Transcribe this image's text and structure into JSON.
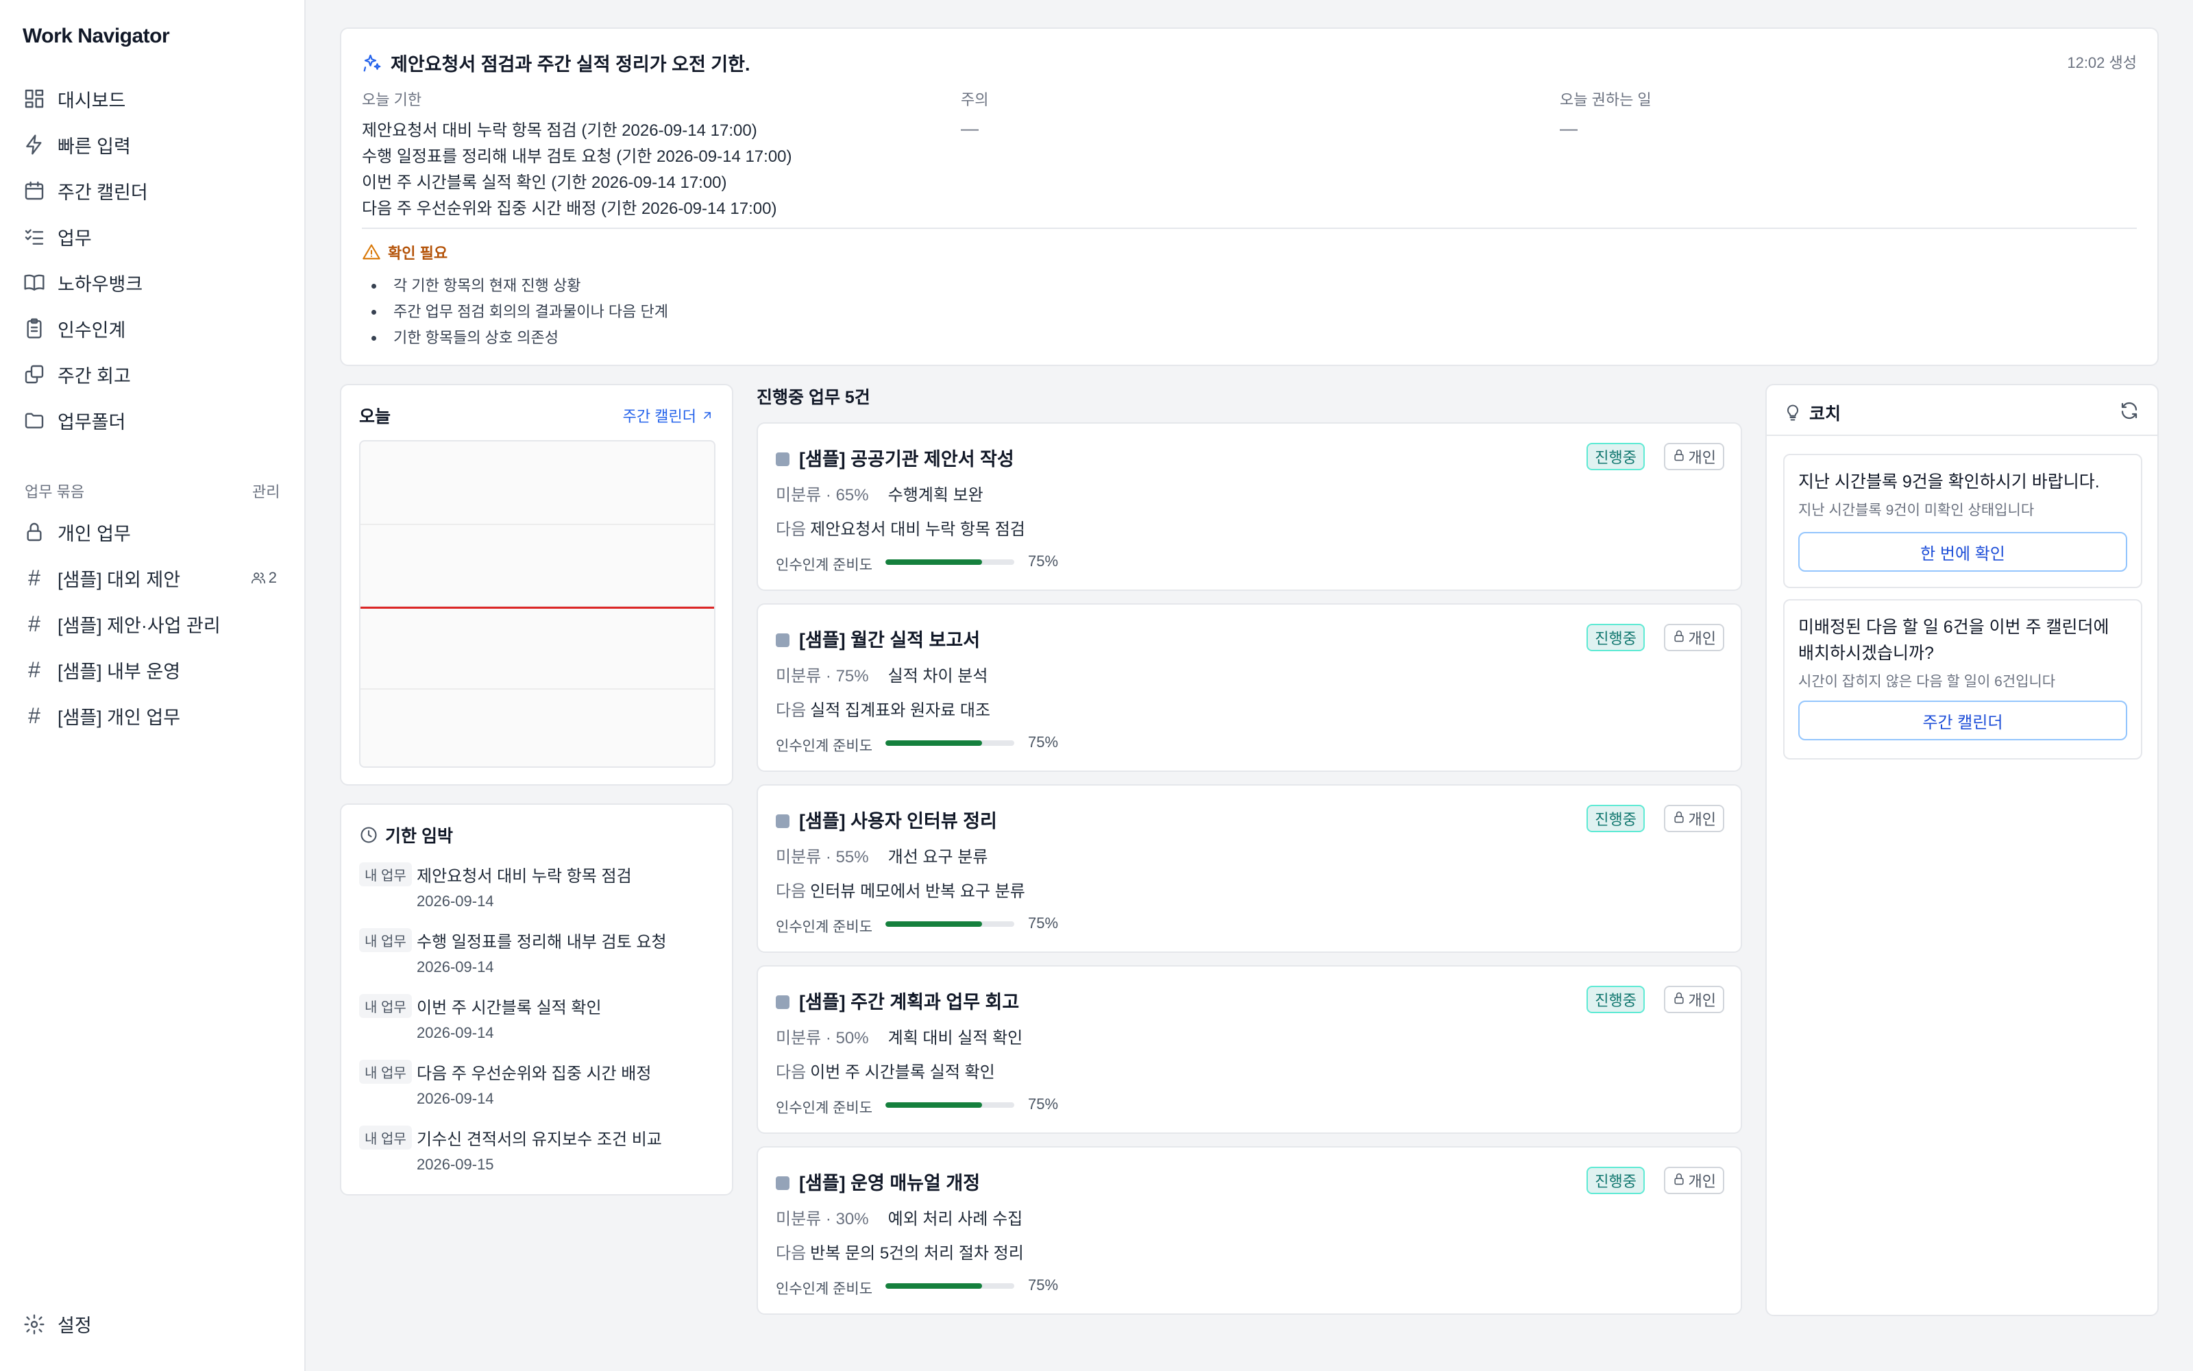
{
  "app": {
    "title": "Work Navigator"
  },
  "sidebar": {
    "nav": [
      {
        "label": "대시보드",
        "icon": "dashboard-icon"
      },
      {
        "label": "빠른 입력",
        "icon": "lightning-icon"
      },
      {
        "label": "주간 캘린더",
        "icon": "calendar-icon"
      },
      {
        "label": "업무",
        "icon": "checklist-icon"
      },
      {
        "label": "노하우뱅크",
        "icon": "book-icon"
      },
      {
        "label": "인수인계",
        "icon": "clipboard-icon"
      },
      {
        "label": "주간 회고",
        "icon": "copy-icon"
      },
      {
        "label": "업무폴더",
        "icon": "folder-icon"
      }
    ],
    "groups_label": "업무 묶음",
    "groups_action": "관리",
    "groups": [
      {
        "label": "개인 업무",
        "icon": "lock-icon"
      },
      {
        "label": "[샘플] 대외 제안",
        "icon": "hash-icon",
        "members": "2"
      },
      {
        "label": "[샘플] 제안·사업 관리",
        "icon": "hash-icon"
      },
      {
        "label": "[샘플] 내부 운영",
        "icon": "hash-icon"
      },
      {
        "label": "[샘플] 개인 업무",
        "icon": "hash-icon"
      }
    ],
    "settings": "설정"
  },
  "summary": {
    "title": "제안요청서 점검과 주간 실적 정리가 오전 기한.",
    "generated": "12:02 생성",
    "due_label": "오늘 기한",
    "due_items": [
      "제안요청서 대비 누락 항목 점검 (기한 2026-09-14 17:00)",
      "수행 일정표를 정리해 내부 검토 요청 (기한 2026-09-14 17:00)",
      "이번 주 시간블록 실적 확인 (기한 2026-09-14 17:00)",
      "다음 주 우선순위와 집중 시간 배정 (기한 2026-09-14 17:00)"
    ],
    "caution_label": "주의",
    "caution_value": "—",
    "recommend_label": "오늘 권하는 일",
    "recommend_value": "—",
    "check_title": "확인 필요",
    "check_items": [
      "각 기한 항목의 현재 진행 상황",
      "주간 업무 점검 회의의 결과물이나 다음 단계",
      "기한 항목들의 상호 의존성"
    ]
  },
  "today": {
    "title": "오늘",
    "link": "주간 캘린더"
  },
  "deadlines": {
    "title": "기한 임박",
    "items": [
      {
        "tag": "내 업무",
        "name": "제안요청서 대비 누락 항목 점검",
        "date": "2026-09-14"
      },
      {
        "tag": "내 업무",
        "name": "수행 일정표를 정리해 내부 검토 요청",
        "date": "2026-09-14"
      },
      {
        "tag": "내 업무",
        "name": "이번 주 시간블록 실적 확인",
        "date": "2026-09-14"
      },
      {
        "tag": "내 업무",
        "name": "다음 주 우선순위와 집중 시간 배정",
        "date": "2026-09-14"
      },
      {
        "tag": "내 업무",
        "name": "기수신 견적서의 유지보수 조건 비교",
        "date": "2026-09-15"
      }
    ]
  },
  "tasks": {
    "header": "진행중 업무 5건",
    "status_label": "진행중",
    "private_label": "개인",
    "next_label": "다음",
    "ready_label": "인수인계 준비도",
    "items": [
      {
        "title": "[샘플] 공공기관 제안서 작성",
        "meta": "미분류 · 65%",
        "step": "수행계획 보완",
        "next": "제안요청서 대비 누락 항목 점검",
        "ready": 0.75,
        "ready_text": "75%"
      },
      {
        "title": "[샘플] 월간 실적 보고서",
        "meta": "미분류 · 75%",
        "step": "실적 차이 분석",
        "next": "실적 집계표와 원자료 대조",
        "ready": 0.75,
        "ready_text": "75%"
      },
      {
        "title": "[샘플] 사용자 인터뷰 정리",
        "meta": "미분류 · 55%",
        "step": "개선 요구 분류",
        "next": "인터뷰 메모에서 반복 요구 분류",
        "ready": 0.75,
        "ready_text": "75%"
      },
      {
        "title": "[샘플] 주간 계획과 업무 회고",
        "meta": "미분류 · 50%",
        "step": "계획 대비 실적 확인",
        "next": "이번 주 시간블록 실적 확인",
        "ready": 0.75,
        "ready_text": "75%"
      },
      {
        "title": "[샘플] 운영 매뉴얼 개정",
        "meta": "미분류 · 30%",
        "step": "예외 처리 사례 수집",
        "next": "반복 문의 5건의 처리 절차 정리",
        "ready": 0.75,
        "ready_text": "75%"
      }
    ]
  },
  "coach": {
    "title": "코치",
    "cards": [
      {
        "title": "지난 시간블록 9건을 확인하시기 바랍니다.",
        "sub": "지난 시간블록 9건이 미확인 상태입니다",
        "button": "한 번에 확인"
      },
      {
        "title": "미배정된 다음 할 일 6건을 이번 주 캘린더에 배치하시겠습니까?",
        "sub": "시간이 잡히지 않은 다음 할 일이 6건입니다",
        "button": "주간 캘린더"
      }
    ]
  }
}
